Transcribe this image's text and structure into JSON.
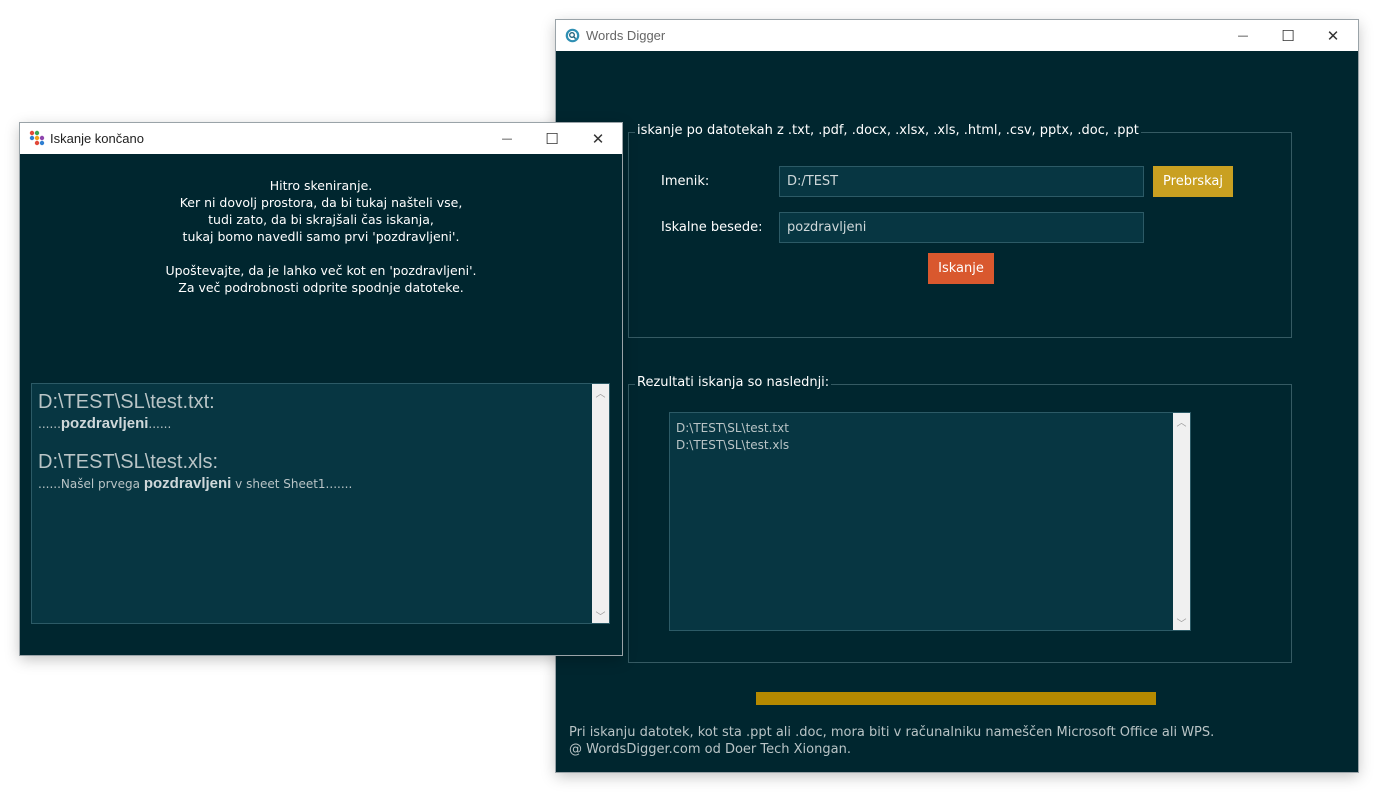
{
  "main_window": {
    "title": "Words Digger",
    "controls": {
      "minimize": "—",
      "maximize": "☐",
      "close": "✕"
    },
    "search_group": {
      "legend": "iskanje po datotekah z .txt, .pdf, .docx, .xlsx, .xls, .html, .csv, pptx, .doc, .ppt",
      "directory_label": "Imenik:",
      "directory_value": "D:/TEST",
      "browse_button": "Prebrskaj",
      "keywords_label": "Iskalne besede:",
      "keywords_value": "pozdravljeni",
      "search_button": "Iskanje"
    },
    "results_group": {
      "legend": "Rezultati iskanja so naslednji:",
      "items": [
        "D:\\TEST\\SL\\test.txt",
        "D:\\TEST\\SL\\test.xls"
      ]
    },
    "progress": 1.0,
    "footer_line1": "Pri iskanju datotek, kot sta .ppt ali .doc, mora biti v računalniku nameščen Microsoft Office ali WPS.",
    "footer_line2": "@ WordsDigger.com od Doer Tech Xiongan."
  },
  "done_window": {
    "title": "Iskanje končano",
    "message_lines": [
      "Hitro skeniranje.",
      "Ker ni dovolj prostora, da bi tukaj našteli vse,",
      "tudi zato, da bi skrajšali čas iskanja,",
      "tukaj bomo navedli samo prvi 'pozdravljeni'.",
      "",
      "Upoštevajte, da je lahko več kot en 'pozdravljeni'.",
      "Za več podrobnosti odprite spodnje datoteke."
    ],
    "results": [
      {
        "path": "D:\\TEST\\SL\\test.txt:",
        "before": "......",
        "keyword": "pozdravljeni",
        "after": "......"
      },
      {
        "path": "D:\\TEST\\SL\\test.xls:",
        "before": "......Našel prvega ",
        "keyword": "pozdravljeni",
        "after": " v sheet Sheet1......."
      }
    ]
  },
  "colors": {
    "window_bg": "#00262f",
    "field_bg": "#073642",
    "browse_button": "#c9a021",
    "search_button": "#d9582e",
    "progress_bar": "#b58900"
  }
}
